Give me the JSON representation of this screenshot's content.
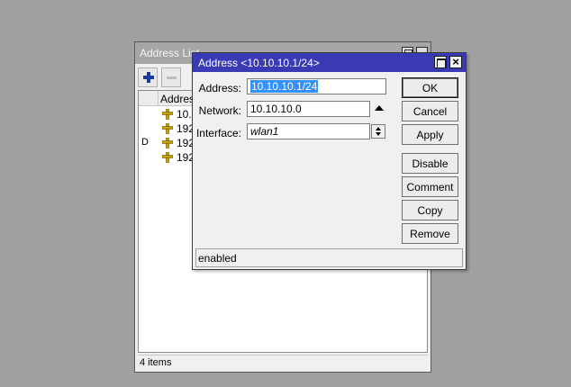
{
  "address_list_window": {
    "title": "Address List",
    "column_header": "Address",
    "rows": [
      {
        "flag": "",
        "address": "10.1"
      },
      {
        "flag": "",
        "address": "192."
      },
      {
        "flag": "D",
        "address": "192."
      },
      {
        "flag": "",
        "address": "192."
      }
    ],
    "status": "4 items"
  },
  "dialog": {
    "title": "Address <10.10.10.1/24>",
    "fields": {
      "address_label": "Address:",
      "address_value": "10.10.10.1/24",
      "network_label": "Network:",
      "network_value": "10.10.10.0",
      "interface_label": "Interface:",
      "interface_value": "wlan1"
    },
    "buttons": {
      "ok": "OK",
      "cancel": "Cancel",
      "apply": "Apply",
      "disable": "Disable",
      "comment": "Comment",
      "copy": "Copy",
      "remove": "Remove"
    },
    "status": "enabled"
  },
  "colors": {
    "desktop": "#a0a0a0",
    "dialog_titlebar": "#3a3ab4",
    "inactive_titlebar": "#a6a6a6",
    "selection": "#3390ff",
    "add_icon": "#1a3aa0",
    "address_icon": "#c8a000"
  },
  "icons": {
    "add": "plus-icon",
    "remove": "minus-icon",
    "address_row": "address-plus-icon",
    "network_toggle": "triangle-up-icon",
    "interface_dropdown": "updown-arrow-icon"
  }
}
